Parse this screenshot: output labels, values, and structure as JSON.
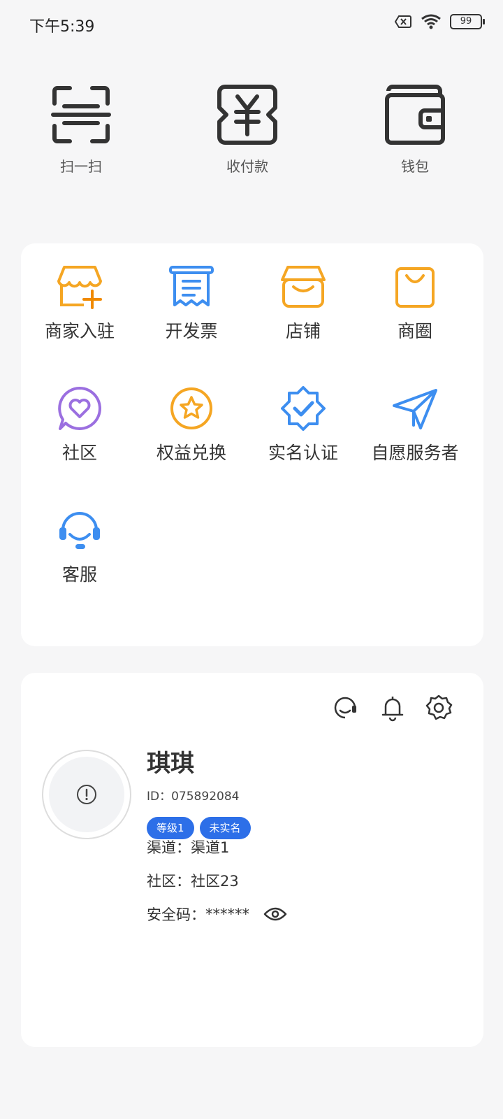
{
  "status_bar": {
    "time": "下午5:39",
    "battery": "99"
  },
  "quick_actions": [
    {
      "label": "扫一扫",
      "icon": "scan-icon"
    },
    {
      "label": "收付款",
      "icon": "yuan-payment-icon"
    },
    {
      "label": "钱包",
      "icon": "wallet-icon"
    }
  ],
  "services": [
    {
      "label": "商家入驻",
      "icon": "store-add-icon",
      "color": "#f5a623"
    },
    {
      "label": "开发票",
      "icon": "receipt-icon",
      "color": "#3d8ef0"
    },
    {
      "label": "店铺",
      "icon": "shop-icon",
      "color": "#f5a623"
    },
    {
      "label": "商圈",
      "icon": "shopping-bag-icon",
      "color": "#f5a623"
    },
    {
      "label": "社区",
      "icon": "heart-chat-icon",
      "color": "#9b6fe0"
    },
    {
      "label": "权益兑换",
      "icon": "star-badge-icon",
      "color": "#f5a623"
    },
    {
      "label": "实名认证",
      "icon": "verified-badge-icon",
      "color": "#3d8ef0"
    },
    {
      "label": "自愿服务者",
      "icon": "paper-plane-icon",
      "color": "#3d8ef0"
    },
    {
      "label": "客服",
      "icon": "headset-icon",
      "color": "#3d8ef0"
    }
  ],
  "profile": {
    "name": "琪琪",
    "id_label": "ID：",
    "id_value": "075892084",
    "badges": [
      "等级1",
      "未实名"
    ],
    "channel_label": "渠道：",
    "channel_value": "渠道1",
    "community_label": "社区：",
    "community_value": "社区23",
    "security_label": "安全码：",
    "security_value": "******"
  }
}
